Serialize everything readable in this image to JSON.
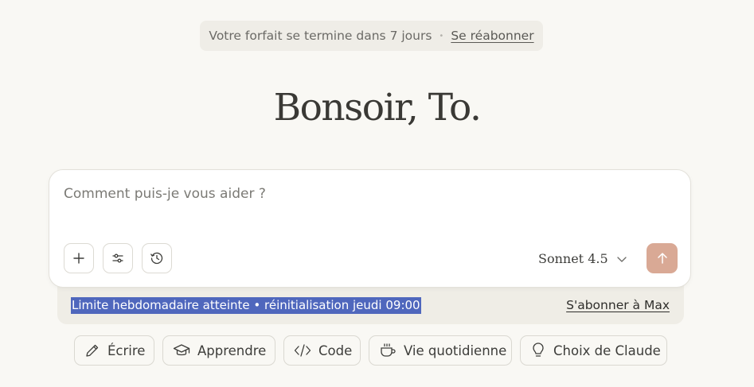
{
  "banner": {
    "text": "Votre forfait se termine dans 7 jours",
    "separator": "•",
    "link": "Se réabonner"
  },
  "greeting": "Bonsoir, To.",
  "composer": {
    "placeholder": "Comment puis-je vous aider ?",
    "model": "Sonnet 4.5",
    "icons": [
      "plus-icon",
      "sliders-icon",
      "clock-icon",
      "chevron-down-icon",
      "arrow-up-icon"
    ]
  },
  "notice": {
    "limit_text": "Limite hebdomadaire atteinte • réinitialisation jeudi 09:00",
    "link": "S'abonner à Max"
  },
  "chips": [
    {
      "label": "Écrire",
      "icon": "pencil-icon"
    },
    {
      "label": "Apprendre",
      "icon": "graduation-cap-icon"
    },
    {
      "label": "Code",
      "icon": "code-icon"
    },
    {
      "label": "Vie quotidienne",
      "icon": "coffee-icon"
    },
    {
      "label": "Choix de Claude",
      "icon": "lightbulb-icon"
    }
  ],
  "colors": {
    "background": "#f9f8f4",
    "send_button": "#d9a995",
    "selection": "#4f67bd"
  }
}
